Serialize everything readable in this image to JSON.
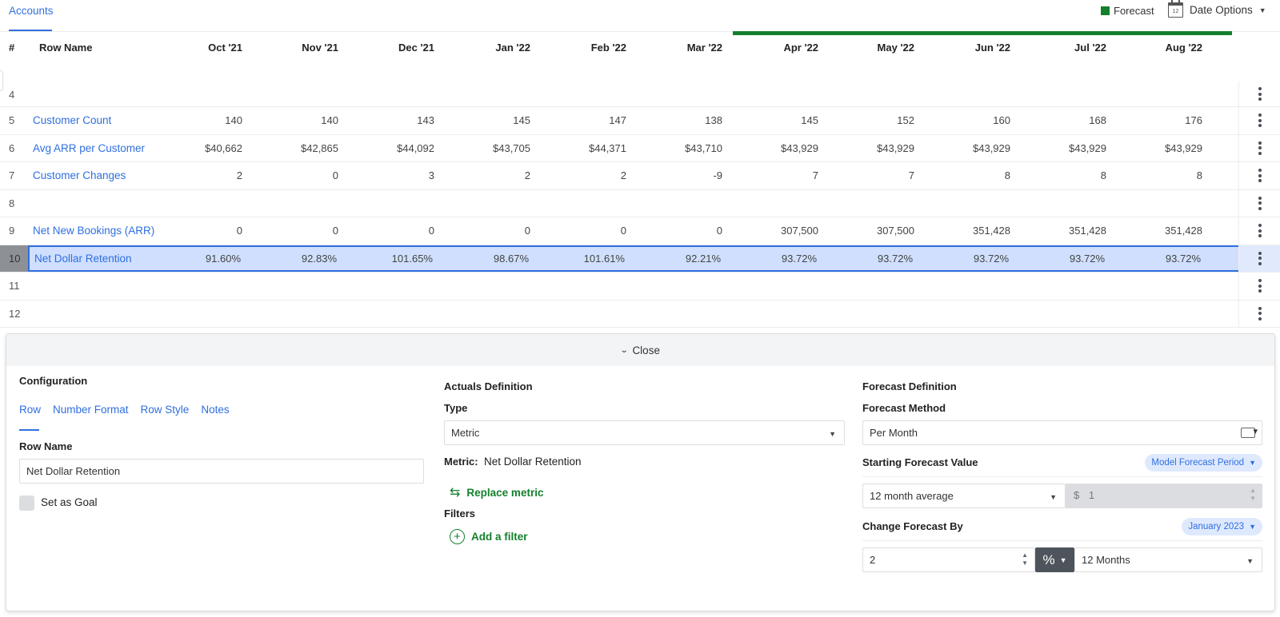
{
  "topbar": {
    "tab": "Accounts",
    "legend_label": "Forecast",
    "legend_color": "#14802c",
    "calendar_day": "12",
    "date_options_label": "Date Options"
  },
  "grid": {
    "header": {
      "num": "#",
      "name": "Row Name",
      "months": [
        "Oct '21",
        "Nov '21",
        "Dec '21",
        "Jan '22",
        "Feb '22",
        "Mar '22",
        "Apr '22",
        "May '22",
        "Jun '22",
        "Jul '22",
        "Aug '22"
      ],
      "forecast_start": "Apr '22"
    },
    "rows": [
      {
        "num": "4",
        "name": "",
        "values": [
          "",
          "",
          "",
          "",
          "",
          "",
          "",
          "",
          "",
          "",
          ""
        ]
      },
      {
        "num": "5",
        "name": "Customer Count",
        "values": [
          "140",
          "140",
          "143",
          "145",
          "147",
          "138",
          "145",
          "152",
          "160",
          "168",
          "176"
        ]
      },
      {
        "num": "6",
        "name": "Avg ARR per Customer",
        "values": [
          "$40,662",
          "$42,865",
          "$44,092",
          "$43,705",
          "$44,371",
          "$43,710",
          "$43,929",
          "$43,929",
          "$43,929",
          "$43,929",
          "$43,929"
        ]
      },
      {
        "num": "7",
        "name": "Customer Changes",
        "values": [
          "2",
          "0",
          "3",
          "2",
          "2",
          "-9",
          "7",
          "7",
          "8",
          "8",
          "8"
        ]
      },
      {
        "num": "8",
        "name": "",
        "values": [
          "",
          "",
          "",
          "",
          "",
          "",
          "",
          "",
          "",
          "",
          ""
        ]
      },
      {
        "num": "9",
        "name": "Net New Bookings (ARR)",
        "values": [
          "0",
          "0",
          "0",
          "0",
          "0",
          "0",
          "307,500",
          "307,500",
          "351,428",
          "351,428",
          "351,428"
        ]
      },
      {
        "num": "10",
        "name": "Net Dollar Retention",
        "selected": true,
        "values": [
          "91.60%",
          "92.83%",
          "101.65%",
          "98.67%",
          "101.61%",
          "92.21%",
          "93.72%",
          "93.72%",
          "93.72%",
          "93.72%",
          "93.72%"
        ]
      },
      {
        "num": "11",
        "name": "",
        "values": [
          "",
          "",
          "",
          "",
          "",
          "",
          "",
          "",
          "",
          "",
          ""
        ]
      },
      {
        "num": "12",
        "name": "",
        "values": [
          "",
          "",
          "",
          "",
          "",
          "",
          "",
          "",
          "",
          "",
          ""
        ]
      }
    ]
  },
  "panel": {
    "close_label": "Close",
    "configuration": {
      "title": "Configuration",
      "tabs": [
        "Row",
        "Number Format",
        "Row Style",
        "Notes"
      ],
      "active_tab": "Row",
      "row_name_label": "Row Name",
      "row_name_value": "Net Dollar Retention",
      "set_as_goal_label": "Set as Goal",
      "set_as_goal_checked": false
    },
    "actuals": {
      "title": "Actuals Definition",
      "type_label": "Type",
      "type_value": "Metric",
      "metric_label": "Metric:",
      "metric_value": "Net Dollar Retention",
      "replace_metric_label": "Replace metric",
      "filters_label": "Filters",
      "add_filter_label": "Add a filter"
    },
    "forecast": {
      "title": "Forecast Definition",
      "method_label": "Forecast Method",
      "method_value": "Per Month",
      "starting_label": "Starting Forecast Value",
      "starting_pill": "Model Forecast Period",
      "starting_select": "12 month average",
      "currency_symbol": "$",
      "starting_amount": "1",
      "change_label": "Change Forecast By",
      "change_pill": "January 2023",
      "change_value": "2",
      "change_unit": "%",
      "change_period": "12 Months"
    }
  }
}
